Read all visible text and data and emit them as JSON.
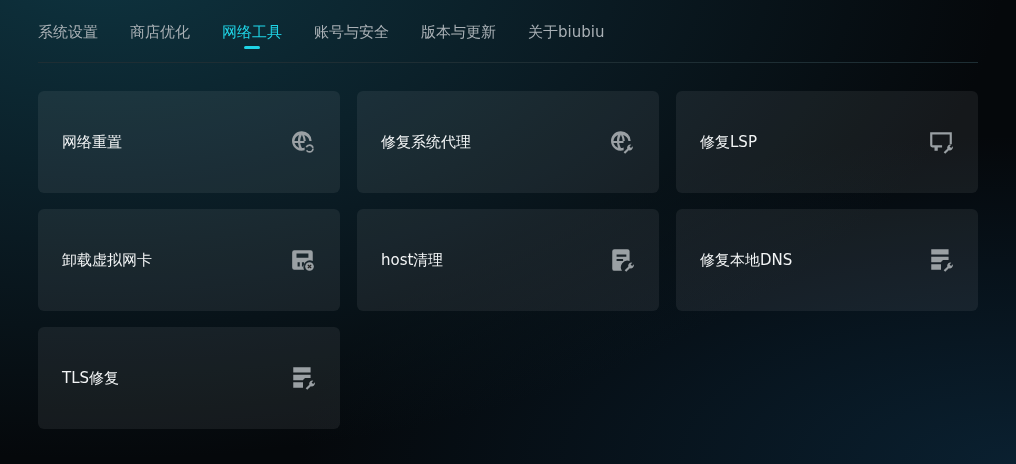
{
  "tabs": [
    {
      "label": "系统设置",
      "selected": false
    },
    {
      "label": "商店优化",
      "selected": false
    },
    {
      "label": "网络工具",
      "selected": true
    },
    {
      "label": "账号与安全",
      "selected": false
    },
    {
      "label": "版本与更新",
      "selected": false
    },
    {
      "label": "关于biubiu",
      "selected": false
    }
  ],
  "tools": [
    {
      "label": "网络重置",
      "kind": "globe-refresh"
    },
    {
      "label": "修复系统代理",
      "kind": "globe-wrench"
    },
    {
      "label": "修复LSP",
      "kind": "monitor-wrench"
    },
    {
      "label": "卸载虚拟网卡",
      "kind": "card-remove"
    },
    {
      "label": "host清理",
      "kind": "document-wrench"
    },
    {
      "label": "修复本地DNS",
      "kind": "server-wrench"
    },
    {
      "label": "TLS修复",
      "kind": "server-wrench"
    }
  ]
}
